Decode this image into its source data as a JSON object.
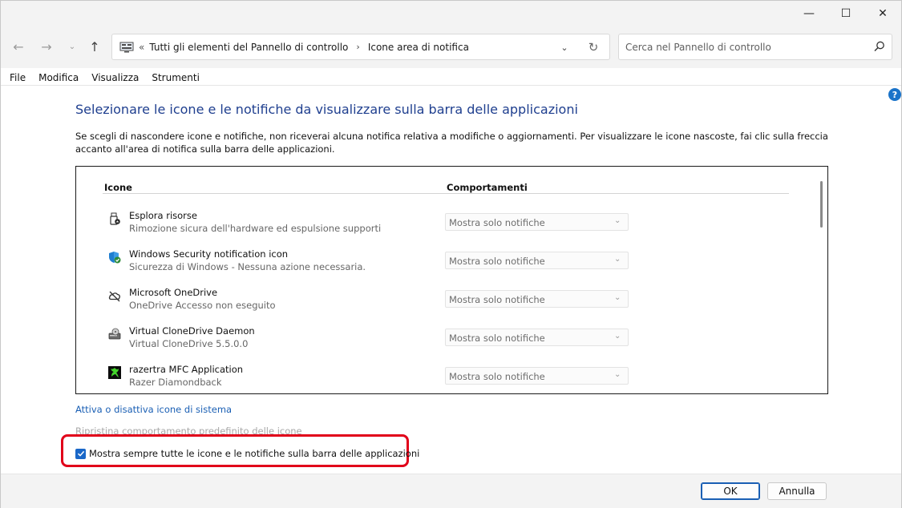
{
  "window": {
    "controls": {
      "minimize": "—",
      "maximize": "☐",
      "close": "✕"
    }
  },
  "nav": {
    "back": "←",
    "forward": "→",
    "recent": "⌄",
    "up": "↑"
  },
  "address": {
    "overflow": "«",
    "segments": [
      "Tutti gli elementi del Pannello di controllo",
      "Icone area di notifica"
    ],
    "separator": "›",
    "dropdown": "⌄",
    "refresh": "↻"
  },
  "search": {
    "placeholder": "Cerca nel Pannello di controllo",
    "value": ""
  },
  "menu": {
    "items": [
      "File",
      "Modifica",
      "Visualizza",
      "Strumenti"
    ]
  },
  "help": {
    "label": "?"
  },
  "main": {
    "title": "Selezionare le icone e le notifiche da visualizzare sulla barra delle applicazioni",
    "description": "Se scegli di nascondere icone e notifiche, non riceverai alcuna notifica relativa a modifiche o aggiornamenti. Per visualizzare le icone nascoste, fai clic sulla freccia accanto all'area di notifica sulla barra delle applicazioni.",
    "columns": {
      "icons": "Icone",
      "behaviors": "Comportamenti"
    },
    "rows": [
      {
        "icon": "usb-eject-icon",
        "name": "Esplora risorse",
        "detail": "Rimozione sicura dell'hardware ed espulsione supporti",
        "behavior": "Mostra solo notifiche"
      },
      {
        "icon": "windows-security-icon",
        "name": "Windows Security notification icon",
        "detail": "Sicurezza di Windows - Nessuna azione necessaria.",
        "behavior": "Mostra solo notifiche"
      },
      {
        "icon": "onedrive-icon",
        "name": "Microsoft OneDrive",
        "detail": "OneDrive Accesso non eseguito",
        "behavior": "Mostra solo notifiche"
      },
      {
        "icon": "clonedrive-icon",
        "name": "Virtual CloneDrive Daemon",
        "detail": "Virtual CloneDrive 5.5.0.0",
        "behavior": "Mostra solo notifiche"
      },
      {
        "icon": "razer-icon",
        "name": "razertra MFC Application",
        "detail": "Razer Diamondback",
        "behavior": "Mostra solo notifiche"
      }
    ],
    "link_system_icons": "Attiva o disattiva icone di sistema",
    "link_restore": "Ripristina comportamento predefinito delle icone",
    "always_show": {
      "label": "Mostra sempre tutte le icone e le notifiche sulla barra delle applicazioni",
      "checked": true
    }
  },
  "footer": {
    "ok": "OK",
    "cancel": "Annulla"
  },
  "colors": {
    "accent": "#1967c8",
    "title": "#1f3f8f",
    "link": "#1a5fb4",
    "highlight": "#e1001a"
  }
}
